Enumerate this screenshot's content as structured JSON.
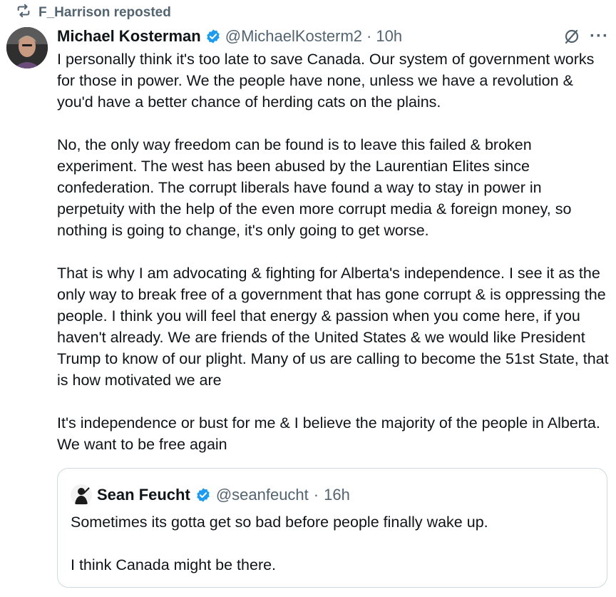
{
  "repost": {
    "label": "F_Harrison reposted",
    "icon": "repost-icon"
  },
  "post": {
    "author_name": "Michael Kosterman",
    "verified": true,
    "handle": "@MichaelKosterm2",
    "separator": "·",
    "time": "10h",
    "paragraphs": [
      "I personally think it's too late to save Canada. Our system of government works for those in power. We the people have none, unless we have a revolution & you'd have a better chance of herding cats on the plains.",
      "No, the only way freedom can be found is to leave this failed & broken experiment. The west has been abused by the Laurentian Elites since confederation. The corrupt liberals have found a way to stay in power in perpetuity with the help of the even more corrupt media & foreign money, so nothing is going to change, it's only going to get worse.",
      "That is why I am advocating & fighting for Alberta's independence. I see it as the only way to break free of a government that has gone corrupt & is oppressing the people. I think you will feel that energy & passion when you come here, if you haven't already. We are friends of the United States & we would like President Trump to know of our plight. Many of us are calling to become the 51st State, that is how motivated we are",
      "It's independence or bust for me & I believe the majority of the people in Alberta. We want to be free again"
    ]
  },
  "quote": {
    "author_name": "Sean Feucht",
    "verified": true,
    "handle": "@seanfeucht",
    "separator": "·",
    "time": "16h",
    "paragraphs": [
      "Sometimes its gotta get so bad before people finally wake up.",
      "I think Canada might be there."
    ]
  },
  "colors": {
    "text": "#0f1419",
    "secondary": "#536471",
    "verified": "#1d9bf0",
    "border": "#cfd9de"
  },
  "icons": {
    "grok": "grok-icon",
    "more": "more-icon",
    "verified": "verified-badge-icon"
  }
}
